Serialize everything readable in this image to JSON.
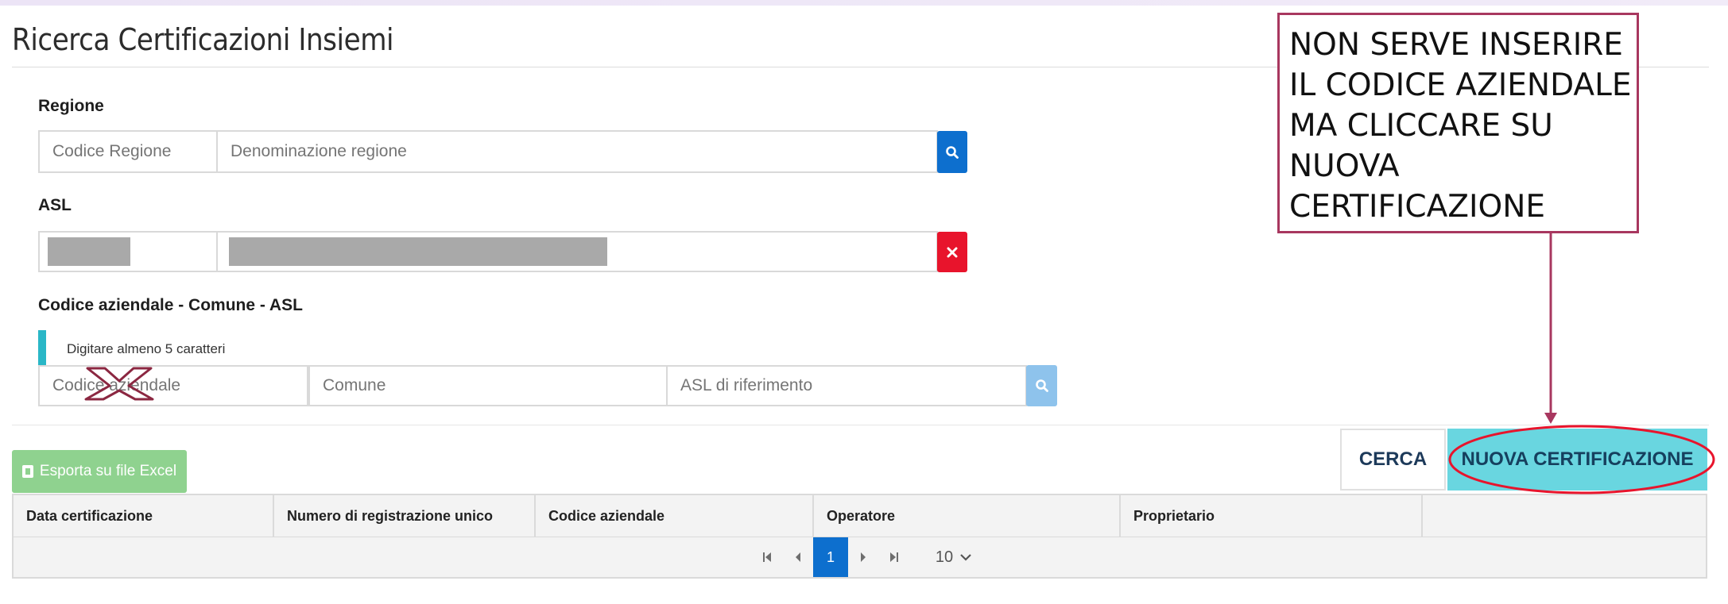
{
  "page": {
    "title": "Ricerca Certificazioni Insiemi"
  },
  "regione": {
    "label": "Regione",
    "codice_placeholder": "Codice Regione",
    "denominazione_placeholder": "Denominazione regione",
    "search_icon": "search-icon"
  },
  "asl": {
    "label": "ASL",
    "clear_icon": "close-icon"
  },
  "codice_aziendale": {
    "label": "Codice aziendale - Comune - ASL",
    "hint": "Digitare almeno 5 caratteri",
    "codice_placeholder": "Codice aziendale",
    "comune_placeholder": "Comune",
    "asl_placeholder": "ASL di riferimento",
    "search_icon": "search-icon"
  },
  "actions": {
    "export_label": "Esporta su file Excel",
    "search_label": "CERCA",
    "new_label": "NUOVA CERTIFICAZIONE"
  },
  "table": {
    "columns": [
      "Data certificazione",
      "Numero di registrazione unico",
      "Codice aziendale",
      "Operatore",
      "Proprietario",
      ""
    ]
  },
  "pagination": {
    "current_page": "1",
    "page_size": "10"
  },
  "annotation": {
    "lines": [
      "NON SERVE INSERIRE",
      "IL CODICE AZIENDALE",
      "MA CLICCARE SU",
      "NUOVA",
      "CERTIFICAZIONE"
    ],
    "accent_color": "#a8375f"
  },
  "colors": {
    "primary_blue": "#0d6fce",
    "danger_red": "#e8142c",
    "light_blue": "#8ec3ec",
    "teal": "#69d6e0",
    "green": "#8fd28f"
  }
}
